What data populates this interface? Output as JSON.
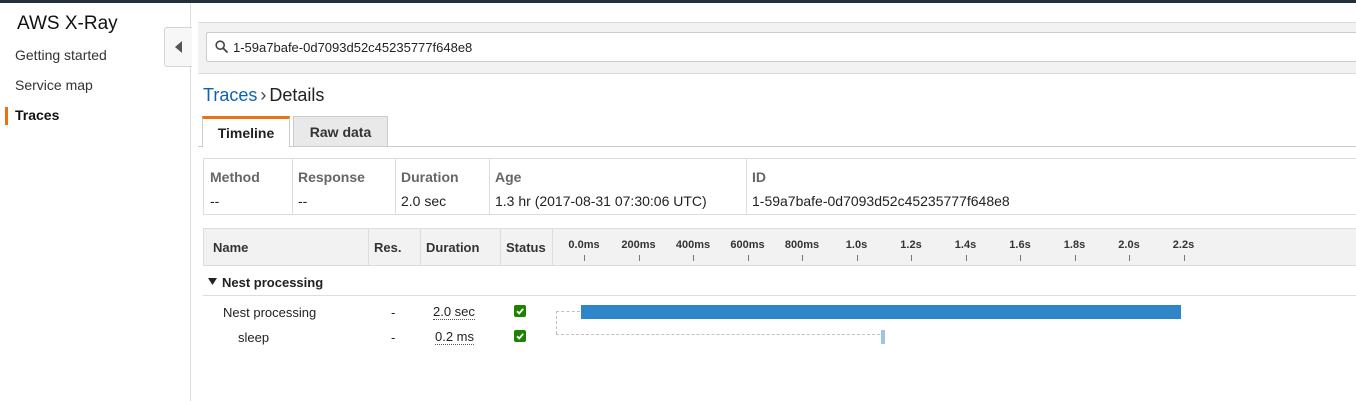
{
  "app": {
    "title": "AWS X-Ray"
  },
  "sidebar": {
    "items": [
      {
        "label": "Getting started",
        "active": false
      },
      {
        "label": "Service map",
        "active": false
      },
      {
        "label": "Traces",
        "active": true
      }
    ]
  },
  "search": {
    "value": "1-59a7bafe-0d7093d52c45235777f648e8",
    "icon": "search-icon"
  },
  "breadcrumb": {
    "link": "Traces",
    "separator": "›",
    "current": "Details"
  },
  "tabs": [
    {
      "label": "Timeline",
      "active": true
    },
    {
      "label": "Raw data",
      "active": false
    }
  ],
  "summary": {
    "method": {
      "header": "Method",
      "value": "--"
    },
    "response": {
      "header": "Response",
      "value": "--"
    },
    "duration": {
      "header": "Duration",
      "value": "2.0 sec"
    },
    "age": {
      "header": "Age",
      "value": "1.3 hr (2017-08-31 07:30:06 UTC)"
    },
    "id": {
      "header": "ID",
      "value": "1-59a7bafe-0d7093d52c45235777f648e8"
    }
  },
  "timeline": {
    "headers": {
      "name": "Name",
      "res": "Res.",
      "duration": "Duration",
      "status": "Status"
    },
    "ticks": [
      "0.0ms",
      "200ms",
      "400ms",
      "600ms",
      "800ms",
      "1.0s",
      "1.2s",
      "1.4s",
      "1.6s",
      "1.8s",
      "2.0s",
      "2.2s"
    ],
    "groups": [
      {
        "label": "Nest processing",
        "rows": [
          {
            "name": "Nest processing",
            "res": "-",
            "duration": "2.0 sec",
            "status": "ok"
          },
          {
            "name": "sleep",
            "res": "-",
            "duration": "0.2 ms",
            "status": "ok"
          }
        ]
      }
    ]
  },
  "colors": {
    "accent": "#ec7211",
    "link": "#0b63b6",
    "bar": "#2e86c8",
    "bar_light": "#9fc3e0",
    "status_ok": "#1d8102"
  }
}
